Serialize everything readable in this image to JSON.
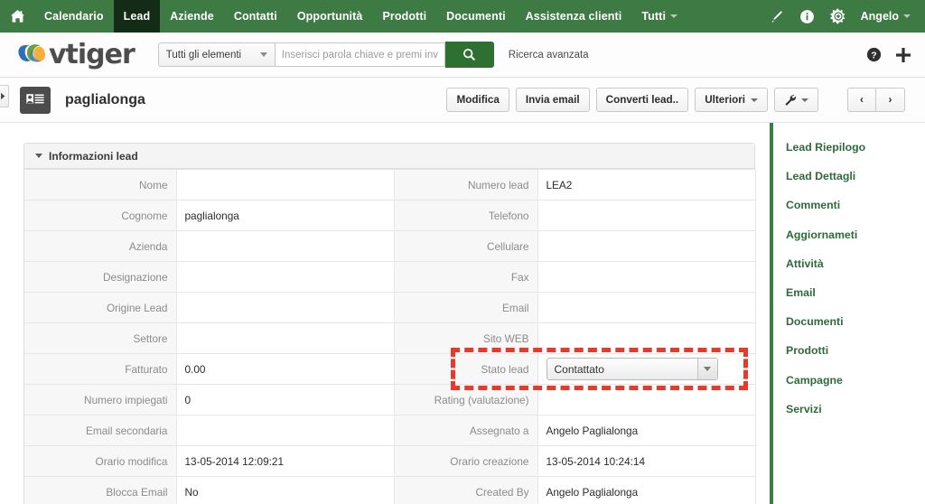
{
  "topnav": {
    "home_icon": "home-icon",
    "items": [
      {
        "label": "Calendario",
        "active": false,
        "caret": false
      },
      {
        "label": "Lead",
        "active": true,
        "caret": false
      },
      {
        "label": "Aziende",
        "active": false,
        "caret": false
      },
      {
        "label": "Contatti",
        "active": false,
        "caret": false
      },
      {
        "label": "Opportunità",
        "active": false,
        "caret": false
      },
      {
        "label": "Prodotti",
        "active": false,
        "caret": false
      },
      {
        "label": "Documenti",
        "active": false,
        "caret": false
      },
      {
        "label": "Assistenza clienti",
        "active": false,
        "caret": false
      },
      {
        "label": "Tutti",
        "active": false,
        "caret": true
      }
    ],
    "right_icons": [
      "brush-icon",
      "info-icon",
      "gear-icon"
    ],
    "user_label": "Angelo",
    "bg_color": "#3d7a44",
    "active_bg_color": "#132b17"
  },
  "search": {
    "logo_text": "vtiger",
    "module_select": "Tutti gli elementi",
    "placeholder": "Inserisci parola chiave e premi invio",
    "value": "",
    "search_icon": "search-icon",
    "advanced_label": "Ricerca avanzata",
    "help_icon": "help-icon",
    "add_icon": "plus-icon",
    "button_color": "#2e7031"
  },
  "titlebar": {
    "record_icon": "contact-card-icon",
    "record_name": "paglialonga",
    "buttons": [
      {
        "label": "Modifica",
        "caret": false
      },
      {
        "label": "Invia email",
        "caret": false
      },
      {
        "label": "Converti lead..",
        "caret": false
      },
      {
        "label": "Ulteriori",
        "caret": true
      }
    ],
    "tools_button": {
      "icon": "wrench-icon",
      "caret": true
    },
    "prev_label": "‹",
    "next_label": "›",
    "side_toggle_icon": "chevron-right-icon"
  },
  "detail_block": {
    "title": "Informazioni lead",
    "rows": [
      {
        "l1": "Nome",
        "v1": "",
        "l2": "Numero lead",
        "v2": "LEA2"
      },
      {
        "l1": "Cognome",
        "v1": "paglialonga",
        "l2": "Telefono",
        "v2": ""
      },
      {
        "l1": "Azienda",
        "v1": "",
        "l2": "Cellulare",
        "v2": ""
      },
      {
        "l1": "Designazione",
        "v1": "",
        "l2": "Fax",
        "v2": ""
      },
      {
        "l1": "Origine Lead",
        "v1": "",
        "l2": "Email",
        "v2": ""
      },
      {
        "l1": "Settore",
        "v1": "",
        "l2": "Sito WEB",
        "v2": ""
      },
      {
        "l1": "Fatturato",
        "v1": "0.00",
        "l2": "Stato lead",
        "v2": "__SELECT__"
      },
      {
        "l1": "Numero impiegati",
        "v1": "0",
        "l2": "Rating (valutazione)",
        "v2": ""
      },
      {
        "l1": "Email secondaria",
        "v1": "",
        "l2": "Assegnato a",
        "v2": "Angelo Paglialonga"
      },
      {
        "l1": "Orario modifica",
        "v1": "13-05-2014 12:09:21",
        "l2": "Orario creazione",
        "v2": "13-05-2014 10:24:14"
      },
      {
        "l1": "Blocca Email",
        "v1": "No",
        "l2": "Created By",
        "v2": "Angelo Paglialonga"
      }
    ],
    "status_select": {
      "value": "Contattato",
      "caret_icon": "chevron-down-icon"
    }
  },
  "highlight": {
    "color": "#e8392b",
    "target": "stato-lead-field"
  },
  "rightbar": {
    "accent_color": "#3a7d46",
    "items": [
      {
        "label": "Lead Riepilogo"
      },
      {
        "label": "Lead Dettagli"
      },
      {
        "label": "Commenti"
      },
      {
        "label": "Aggiornameti"
      },
      {
        "label": "Attività"
      },
      {
        "label": "Email"
      },
      {
        "label": "Documenti"
      },
      {
        "label": "Prodotti"
      },
      {
        "label": "Campagne"
      },
      {
        "label": "Servizi"
      }
    ]
  }
}
